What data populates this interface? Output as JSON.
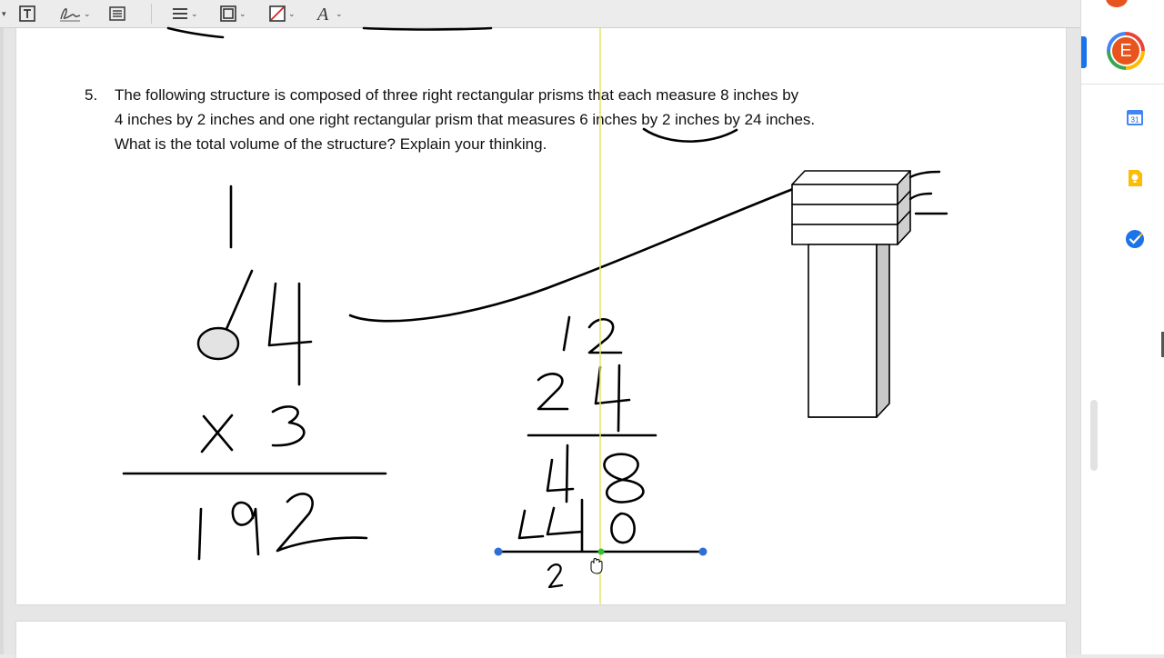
{
  "toolbar": {
    "items": [
      "text-tool",
      "signature-tool",
      "note-tool",
      "line-style",
      "border-color",
      "fill-color",
      "font-style"
    ]
  },
  "problem": {
    "number": "5.",
    "line1": "The following structure is composed of three right rectangular prisms that each measure 8 inches by",
    "line2": "4 inches by 2 inches and one right rectangular prism that measures 6 inches by 2 inches by 24 inches.",
    "line3": "What is the total volume of the structure?  Explain your thinking."
  },
  "sidebar": {
    "avatar_letter": "E",
    "calendar_day": "31",
    "icons": [
      "calendar-icon",
      "keep-icon",
      "tasks-icon"
    ]
  },
  "colors": {
    "guide": "#e6e26a",
    "handle": "#2e6fd6",
    "handle_mid": "#2fc42f",
    "avatar": "#e8541e"
  }
}
